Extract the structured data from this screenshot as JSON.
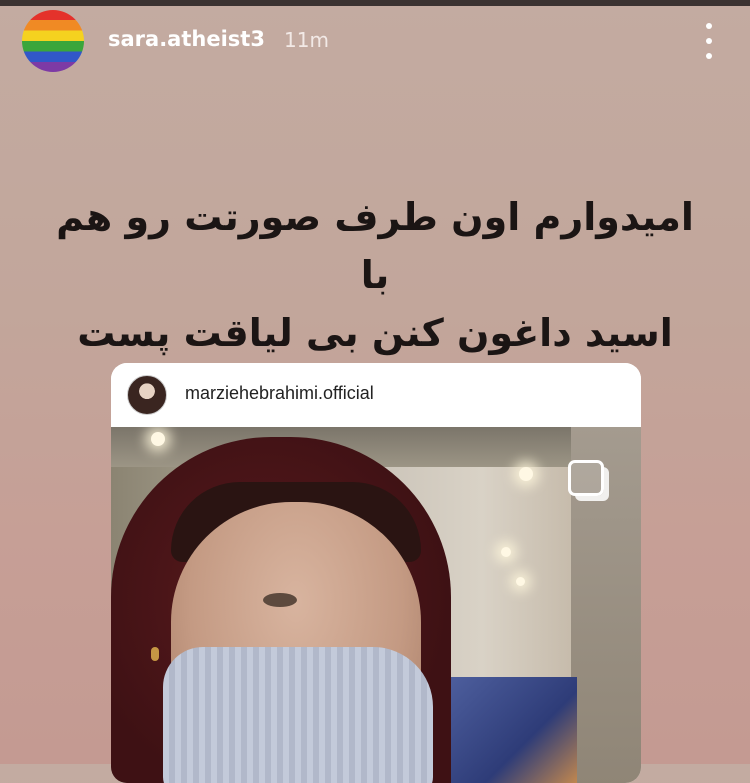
{
  "story": {
    "username": "sara.atheist3",
    "time_ago": "11m",
    "caption_line1": "امیدوارم اون طرف صورتت رو هم با",
    "caption_line2": "اسید داغون کنن بی لیاقت پست"
  },
  "shared_post": {
    "username": "marziehebrahimi.official"
  },
  "icons": {
    "avatar": "rainbow-avatar",
    "more": "more-vertical-icon",
    "multi": "multiple-photos-icon"
  }
}
